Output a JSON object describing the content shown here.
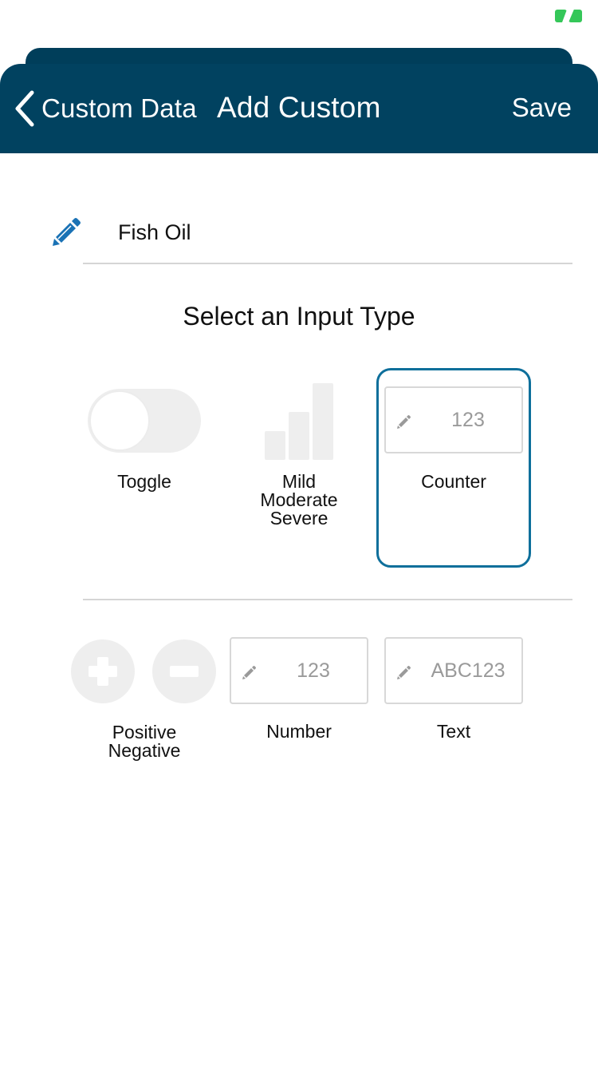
{
  "status_bar": {
    "battery_icon": "battery-charging-icon",
    "battery_color": "#35c759"
  },
  "nav": {
    "back_label": "Custom Data",
    "title": "Add Custom",
    "save_label": "Save",
    "background": "#014260"
  },
  "name_field": {
    "value": "Fish Oil",
    "icon": "pencil-icon",
    "icon_color": "#1a72b5"
  },
  "section_title": "Select an Input Type",
  "input_types": {
    "toggle": {
      "label": "Toggle"
    },
    "severity": {
      "label_lines": [
        "Mild",
        "Moderate",
        "Severe"
      ]
    },
    "counter": {
      "label": "Counter",
      "placeholder": "123",
      "selected": true
    },
    "positive_negative": {
      "label_lines": [
        "Positive",
        "Negative"
      ]
    },
    "number": {
      "label": "Number",
      "placeholder": "123"
    },
    "text": {
      "label": "Text",
      "placeholder": "ABC123"
    }
  },
  "colors": {
    "selection_border": "#0e6f9b",
    "inactive_shape": "#eeeeee"
  }
}
